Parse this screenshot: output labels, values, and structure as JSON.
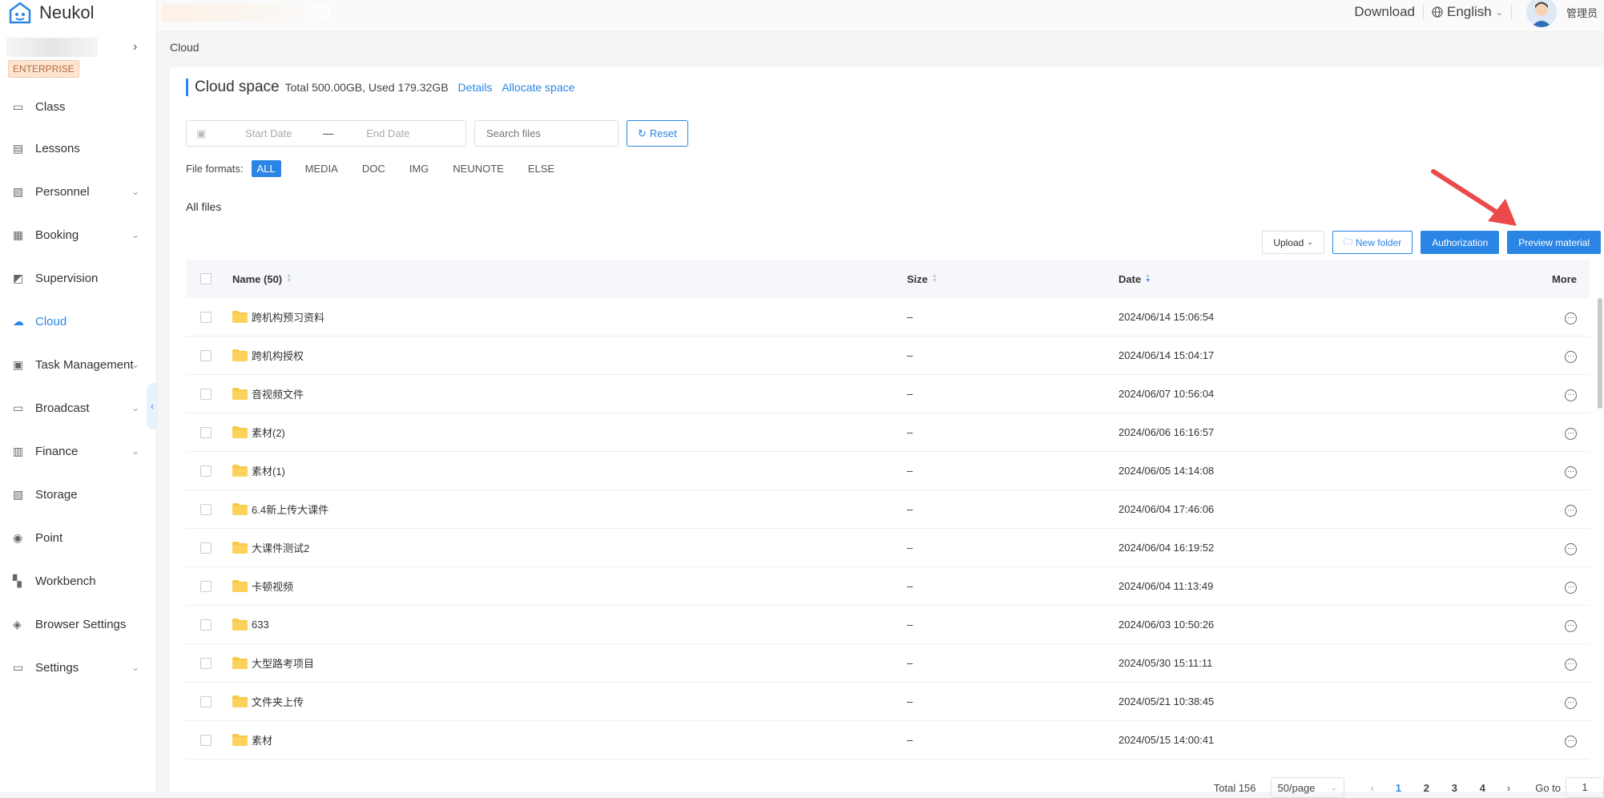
{
  "app": {
    "name": "Neukol"
  },
  "sidebar": {
    "badge": "ENTERPRISE",
    "items": [
      {
        "label": "Class",
        "icon": "class-icon",
        "expandable": false,
        "active": false
      },
      {
        "label": "Lessons",
        "icon": "lessons-icon",
        "expandable": false,
        "active": false
      },
      {
        "label": "Personnel",
        "icon": "personnel-icon",
        "expandable": true,
        "active": false
      },
      {
        "label": "Booking",
        "icon": "booking-icon",
        "expandable": true,
        "active": false
      },
      {
        "label": "Supervision",
        "icon": "supervision-icon",
        "expandable": false,
        "active": false
      },
      {
        "label": "Cloud",
        "icon": "cloud-icon",
        "expandable": false,
        "active": true
      },
      {
        "label": "Task Management",
        "icon": "task-icon",
        "expandable": true,
        "active": false
      },
      {
        "label": "Broadcast",
        "icon": "broadcast-icon",
        "expandable": true,
        "active": false
      },
      {
        "label": "Finance",
        "icon": "finance-icon",
        "expandable": true,
        "active": false
      },
      {
        "label": "Storage",
        "icon": "storage-icon",
        "expandable": false,
        "active": false
      },
      {
        "label": "Point",
        "icon": "point-icon",
        "expandable": false,
        "active": false
      },
      {
        "label": "Workbench",
        "icon": "workbench-icon",
        "expandable": false,
        "active": false
      },
      {
        "label": "Browser Settings",
        "icon": "browser-settings-icon",
        "expandable": false,
        "active": false
      },
      {
        "label": "Settings",
        "icon": "settings-icon",
        "expandable": true,
        "active": false
      }
    ]
  },
  "header": {
    "download": "Download",
    "language": "English",
    "user": "管理员"
  },
  "breadcrumb": "Cloud",
  "space": {
    "title": "Cloud space",
    "quota": "Total 500.00GB,  Used 179.32GB",
    "details": "Details",
    "allocate": "Allocate space"
  },
  "filters": {
    "start_placeholder": "Start Date",
    "end_placeholder": "End Date",
    "search_placeholder": "Search files",
    "reset": "Reset",
    "formats_label": "File formats:",
    "formats": [
      "ALL",
      "MEDIA",
      "DOC",
      "IMG",
      "NEUNOTE",
      "ELSE"
    ],
    "active_format": "ALL"
  },
  "section_title": "All files",
  "toolbar": {
    "upload": "Upload",
    "new_folder": "New folder",
    "authorization": "Authorization",
    "preview": "Preview material"
  },
  "table": {
    "headers": {
      "name": "Name (50)",
      "size": "Size",
      "date": "Date",
      "more": "More"
    },
    "rows": [
      {
        "name": "跨机构预习资料",
        "size": "–",
        "date": "2024/06/14 15:06:54"
      },
      {
        "name": "跨机构授权",
        "size": "–",
        "date": "2024/06/14 15:04:17"
      },
      {
        "name": "音视频文件",
        "size": "–",
        "date": "2024/06/07 10:56:04"
      },
      {
        "name": "素材(2)",
        "size": "–",
        "date": "2024/06/06 16:16:57"
      },
      {
        "name": "素材(1)",
        "size": "–",
        "date": "2024/06/05 14:14:08"
      },
      {
        "name": "6.4新上传大课件",
        "size": "–",
        "date": "2024/06/04 17:46:06"
      },
      {
        "name": "大课件测试2",
        "size": "–",
        "date": "2024/06/04 16:19:52"
      },
      {
        "name": "卡顿视频",
        "size": "–",
        "date": "2024/06/04 11:13:49"
      },
      {
        "name": "633",
        "size": "–",
        "date": "2024/06/03 10:50:26"
      },
      {
        "name": "大型路考项目",
        "size": "–",
        "date": "2024/05/30 15:11:11"
      },
      {
        "name": "文件夹上传",
        "size": "–",
        "date": "2024/05/21 10:38:45"
      },
      {
        "name": "素材",
        "size": "–",
        "date": "2024/05/15 14:00:41"
      }
    ]
  },
  "pagination": {
    "total": "Total 156",
    "page_size": "50/page",
    "pages": [
      "1",
      "2",
      "3",
      "4"
    ],
    "current": "1",
    "goto_label": "Go to",
    "goto_value": "1"
  },
  "colors": {
    "accent": "#2b85e4",
    "folder": "#f7c948",
    "annotation_arrow": "#ec4a4a"
  }
}
